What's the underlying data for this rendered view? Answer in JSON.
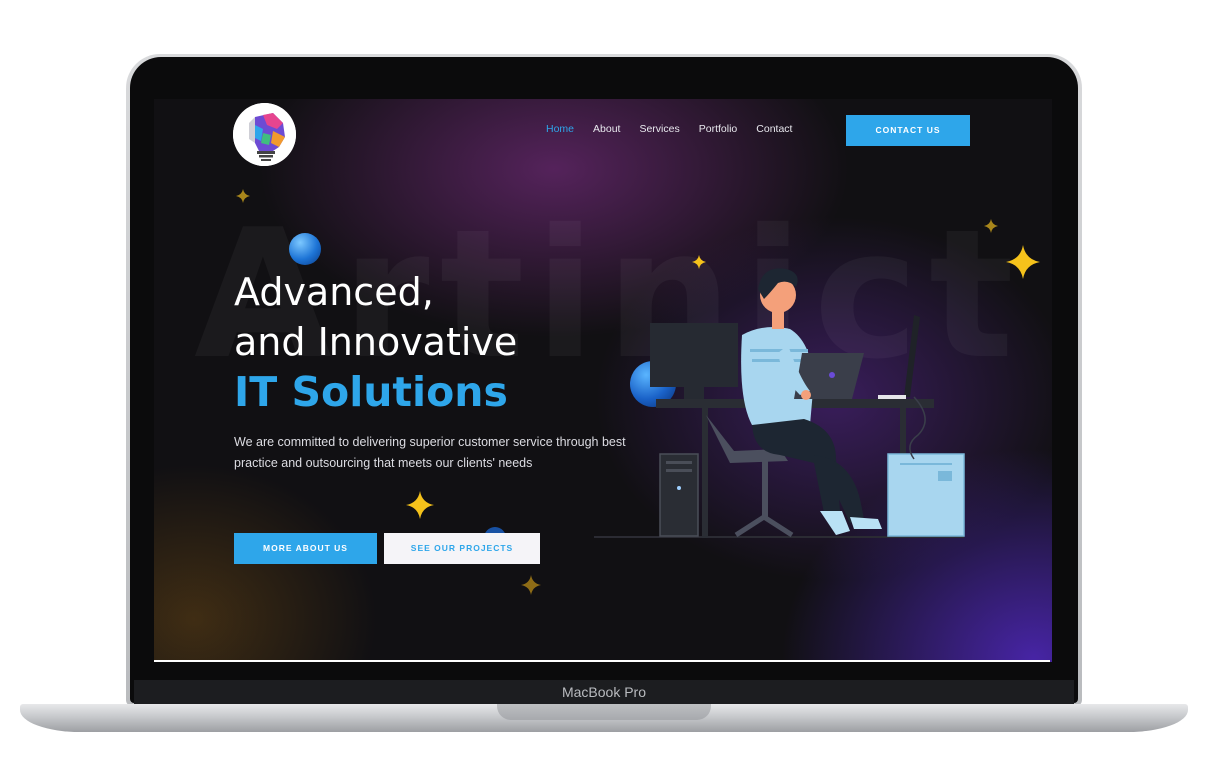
{
  "device": {
    "label": "MacBook Pro"
  },
  "site": {
    "watermark": "Artinict",
    "nav": [
      {
        "label": "Home",
        "active": true
      },
      {
        "label": "About",
        "active": false
      },
      {
        "label": "Services",
        "active": false
      },
      {
        "label": "Portfolio",
        "active": false
      },
      {
        "label": "Contact",
        "active": false
      }
    ],
    "contact_button": "CONTACT US",
    "hero": {
      "line1": "Advanced,",
      "line2": "and Innovative",
      "line3": "IT Solutions",
      "description": "We are committed to delivering superior customer service through best practice and outsourcing that meets our clients' needs",
      "primary_button": "MORE ABOUT US",
      "secondary_button": "SEE OUR PROJECTS"
    },
    "colors": {
      "accent": "#2ea6ea",
      "background": "#111013",
      "spark": "#f5c21b"
    },
    "icons": [
      "logo-head-icon",
      "sparkle-icon",
      "sphere-decoration",
      "developer-illustration"
    ]
  }
}
